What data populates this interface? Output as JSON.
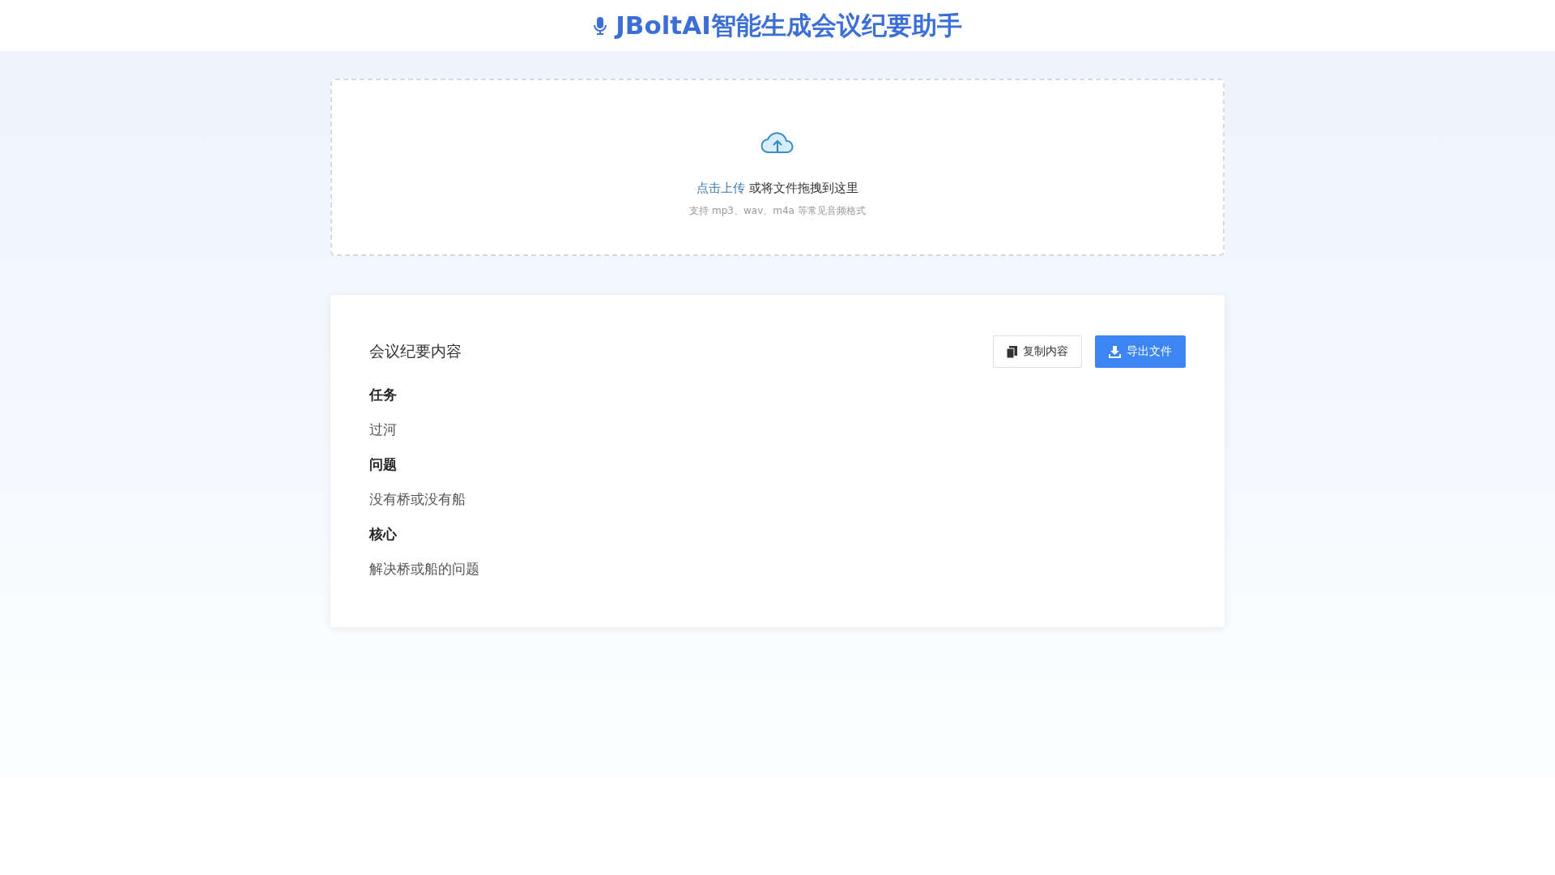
{
  "header": {
    "title": "JBoltAI智能生成会议纪要助手"
  },
  "upload": {
    "link": "点击上传",
    "text": "或将文件拖拽到这里",
    "hint": "支持 mp3、wav、m4a 等常见音频格式"
  },
  "minutes": {
    "title": "会议纪要内容",
    "buttons": [
      {
        "label": "复制内容",
        "kind": "copy"
      },
      {
        "label": "导出文件",
        "kind": "export"
      }
    ],
    "content": [
      {
        "kind": "heading",
        "text": "任务"
      },
      {
        "kind": "paragraph",
        "text": "过河"
      },
      {
        "kind": "heading",
        "text": "问题"
      },
      {
        "kind": "paragraph",
        "text": "没有桥或没有船"
      },
      {
        "kind": "heading",
        "text": "核心"
      },
      {
        "kind": "paragraph",
        "text": "解决桥或船的问题"
      }
    ]
  }
}
